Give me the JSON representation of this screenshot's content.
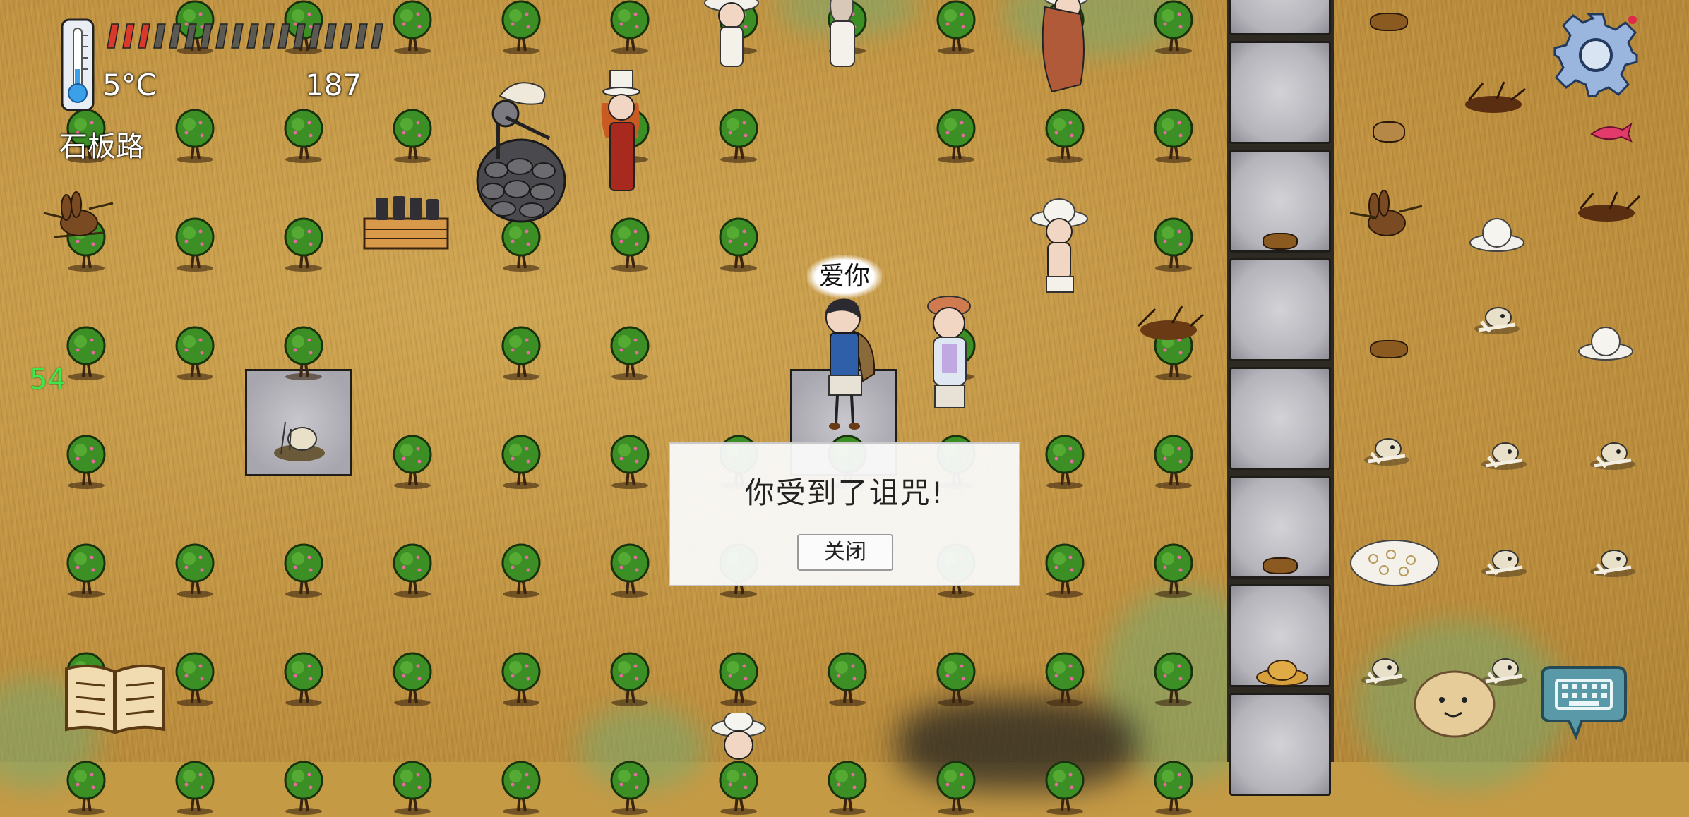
{
  "hud": {
    "temperature": "5°C",
    "food_value": "187",
    "tile_name": "石板路",
    "side_counter": "54",
    "food_pips_total": 18,
    "food_pips_filled": 3,
    "food_color": "#d93a2b",
    "thermometer_icon": "thermometer-icon"
  },
  "speech": {
    "text": "爱你"
  },
  "dialog": {
    "message": "你受到了诅咒!",
    "close_label": "关闭"
  },
  "controls": {
    "settings_icon": "gear-icon",
    "book_icon": "recipe-book-icon",
    "emote_icon": "emote-face-icon",
    "keyboard_icon": "keyboard-icon"
  },
  "colors": {
    "ground": "#c59a45",
    "road": "#b5b4bb",
    "tree_leaf": "#3c8f25",
    "counter_green": "#3ee84a",
    "dialog_bg": "#fafafa"
  }
}
